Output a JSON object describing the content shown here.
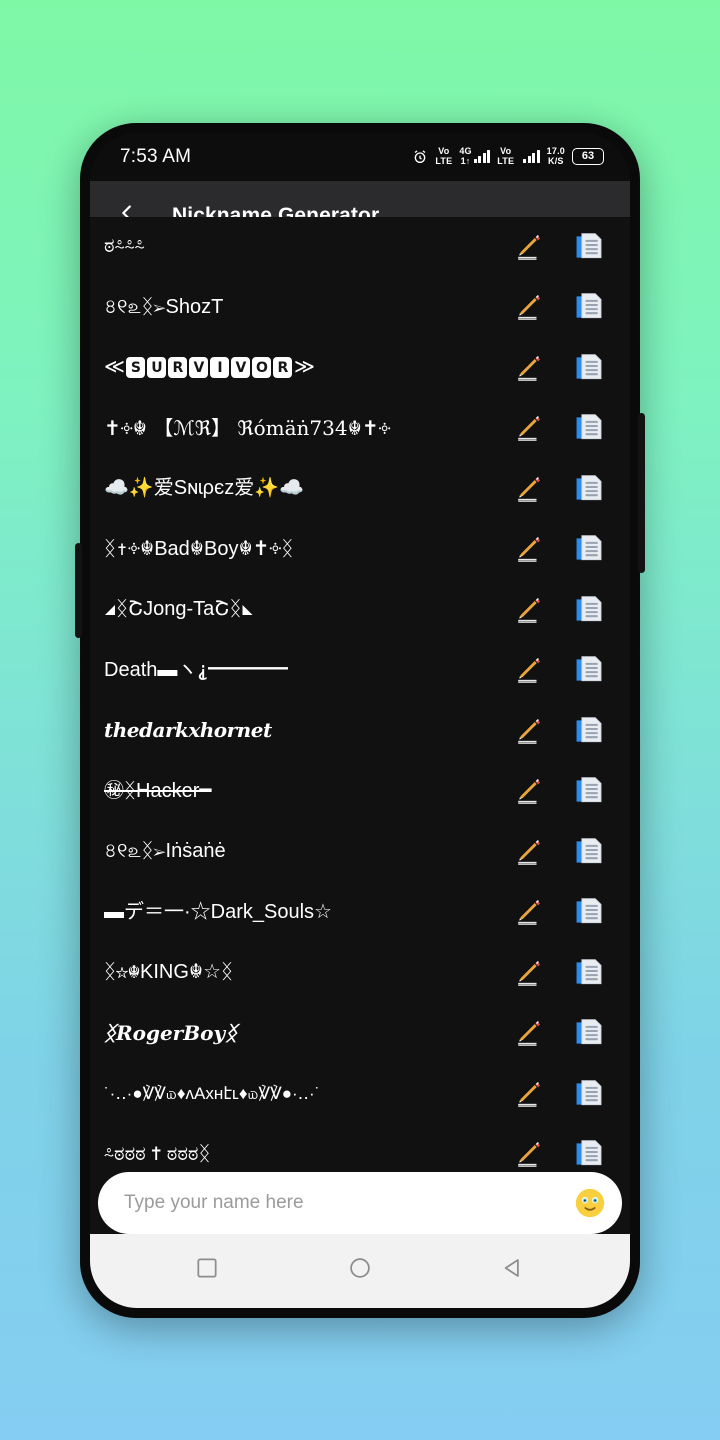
{
  "status_bar": {
    "time": "7:53 AM",
    "alarm_icon": "alarm-clock-icon",
    "sim1_network": {
      "line1": "Vo",
      "line2": "LTE"
    },
    "sim1_generation": {
      "line1": "4G",
      "line2": "1↑"
    },
    "sim2_network": {
      "line1": "Vo",
      "line2": "LTE"
    },
    "data_rate": {
      "line1": "17.0",
      "line2": "K/S"
    },
    "battery_percent": "63"
  },
  "app_bar": {
    "back_icon": "chevron-left-icon",
    "title": "Nickname Generator"
  },
  "list": {
    "items": [
      {
        "text": "ಠ⸛⸛⸛",
        "style": "partial"
      },
      {
        "text": "৪୧௨ᛝ➢ShozT",
        "style": "plain"
      },
      {
        "text": "≪",
        "style": "boxed",
        "boxed_letters": [
          "S",
          "U",
          "R",
          "V",
          "I",
          "V",
          "O",
          "R"
        ],
        "suffix": "≫"
      },
      {
        "text": "✝༓☬ 【ℳℜ】 ℜómäṅ734☬✝༓",
        "style": "serif"
      },
      {
        "text": "☁️✨爱Sɴɩρєz爱✨☁️",
        "style": "plain"
      },
      {
        "text": "ᛝ✝༓☬Bad☬Boy☬✝༓ᛝ",
        "style": "plain"
      },
      {
        "text": "◢ᛝՇJong-TaՇᛝ◣",
        "style": "plain"
      },
      {
        "text": "Death▬ヽ⸘━━━━",
        "style": "plain"
      },
      {
        "text": "thedarkxhornet",
        "style": "blackletter"
      },
      {
        "text": "㊙ᛝHacker━",
        "style": "strike"
      },
      {
        "text": "৪୧௨ᛝ➢Iṅṡaṅė",
        "style": "plain"
      },
      {
        "text": "▬デ＝一·☆Dark_Souls☆",
        "style": "plain"
      },
      {
        "text": "ᛝ☆☬KING☬☆ᛝ",
        "style": "plain"
      },
      {
        "text": "ᛝRogerBoyᛝ",
        "style": "script"
      },
      {
        "text": "˙·‥·●℣℣௰♦ʌAхʜէʟ♦௰℣℣●·‥·˙",
        "style": "small"
      },
      {
        "text": "⸛ಠಠಠ ✝ ಠಠಠᛝ",
        "style": "partial-bottom"
      }
    ],
    "edit_icon": "pencil-edit-icon",
    "copy_icon": "copy-clipboard-icon"
  },
  "input_bar": {
    "placeholder": "Type your name here",
    "value": "",
    "emoji_icon": "smiley-face-icon"
  },
  "nav_bar": {
    "recents_icon": "square-recents-icon",
    "home_icon": "circle-home-icon",
    "back_icon": "triangle-back-icon"
  },
  "colors": {
    "background_top": "#7ff8a6",
    "background_bottom": "#85cdf2",
    "app_bar": "#2b2b2e",
    "list_bg": "#111112",
    "accent_blue": "#2e8ced",
    "nav_bar": "#f2f2f2"
  }
}
